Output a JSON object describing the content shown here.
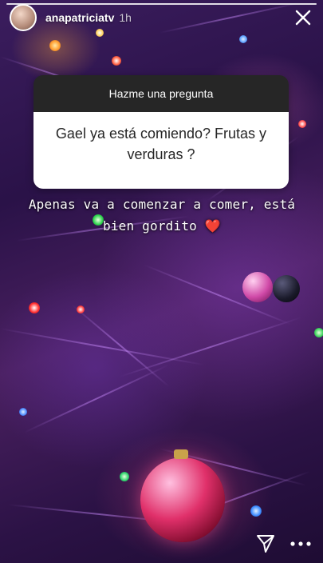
{
  "story": {
    "username": "anapatriciatv",
    "time_ago": "1h",
    "question_sticker": {
      "header": "Hazme una pregunta",
      "question": "Gael ya está comiendo? Frutas y verduras ?"
    },
    "answer_text": "Apenas va a comenzar a comer, está bien gordito",
    "answer_emoji": "❤️"
  },
  "icons": {
    "close": "close-icon",
    "send": "direct-send-icon",
    "more": "more-options-icon"
  },
  "colors": {
    "sticker_header_bg": "#262626",
    "sticker_body_bg": "#ffffff",
    "heart": "#e8222f"
  }
}
